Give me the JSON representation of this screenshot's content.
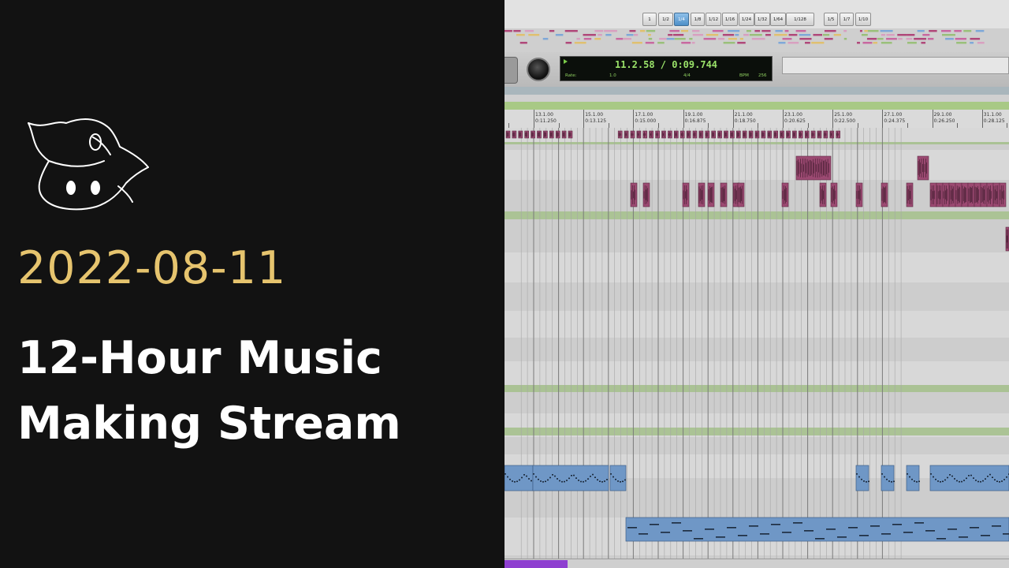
{
  "stream": {
    "date": "2022-08-11",
    "title_line1": "12-Hour Music",
    "title_line2": "Making Stream",
    "logo_icon": "wizard-hat-mascot-icon",
    "colors": {
      "background": "#121212",
      "date": "#e6c46e",
      "title": "#ffffff"
    }
  },
  "daw": {
    "grid_values": [
      "1",
      "1/2",
      "1/4",
      "1/8",
      "1/12",
      "1/16",
      "1/24",
      "1/32",
      "1/64",
      "1/128"
    ],
    "grid_selected": "1/4",
    "tuplet_values": [
      "1/5",
      "1/7",
      "1/10"
    ],
    "counter": {
      "main": "11.2.58 / 0:09.744",
      "rate_label": "Rate:",
      "rate_value": "1.0",
      "meter": "4/4",
      "bpm_label": "BPM",
      "bpm_value": "256"
    },
    "ruler": [
      {
        "bar": "13.1.00",
        "time": "0:11.250"
      },
      {
        "bar": "15.1.00",
        "time": "0:13.125"
      },
      {
        "bar": "17.1.00",
        "time": "0:15.000"
      },
      {
        "bar": "19.1.00",
        "time": "0:16.875"
      },
      {
        "bar": "21.1.00",
        "time": "0:18.750"
      },
      {
        "bar": "23.1.00",
        "time": "0:20.625"
      },
      {
        "bar": "25.1.00",
        "time": "0:22.500"
      },
      {
        "bar": "27.1.00",
        "time": "0:24.375"
      },
      {
        "bar": "29.1.00",
        "time": "0:26.250"
      },
      {
        "bar": "31.1.00",
        "time": "0:28.125"
      }
    ],
    "colors": {
      "audio_clip": "#9c4a72",
      "midi_clip": "#6f97c6",
      "marker": "#a8c985",
      "counter_text": "#9be36a",
      "scroll_thumb": "#8e3fd0"
    }
  }
}
